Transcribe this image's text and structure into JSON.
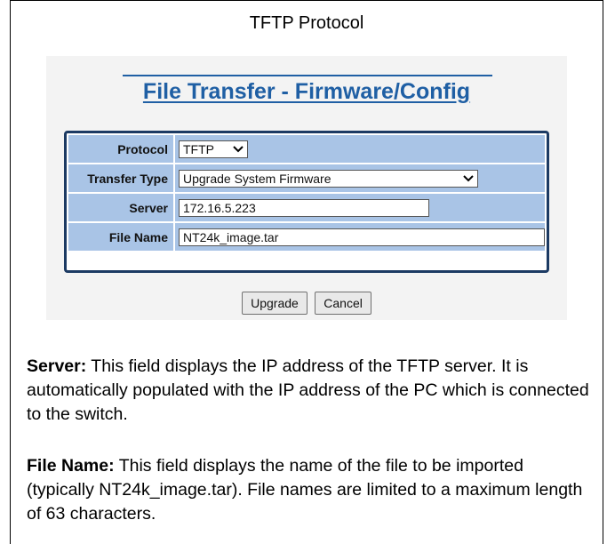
{
  "section_title": "TFTP Protocol",
  "page_heading": "File Transfer - Firmware/Config",
  "form": {
    "protocol_label": "Protocol",
    "protocol_value": "TFTP",
    "transfer_type_label": "Transfer Type",
    "transfer_type_value": "Upgrade System Firmware",
    "server_label": "Server",
    "server_value": "172.16.5.223",
    "file_name_label": "File Name",
    "file_name_value": "NT24k_image.tar"
  },
  "buttons": {
    "upgrade": "Upgrade",
    "cancel": "Cancel"
  },
  "descriptions": {
    "server_term": "Server:",
    "server_text": " This field displays the IP address of the TFTP server. It is automatically populated with the IP address of the PC which is connected to the switch.",
    "file_name_term": "File Name:",
    "file_name_text": " This field displays the name of the file to be imported (typically NT24k_image.tar). File names are limited to a maximum length of 63 characters."
  },
  "colors": {
    "heading": "#1f5fa4",
    "label_cell": "#a9c4e6",
    "form_border": "#1c3a63"
  }
}
